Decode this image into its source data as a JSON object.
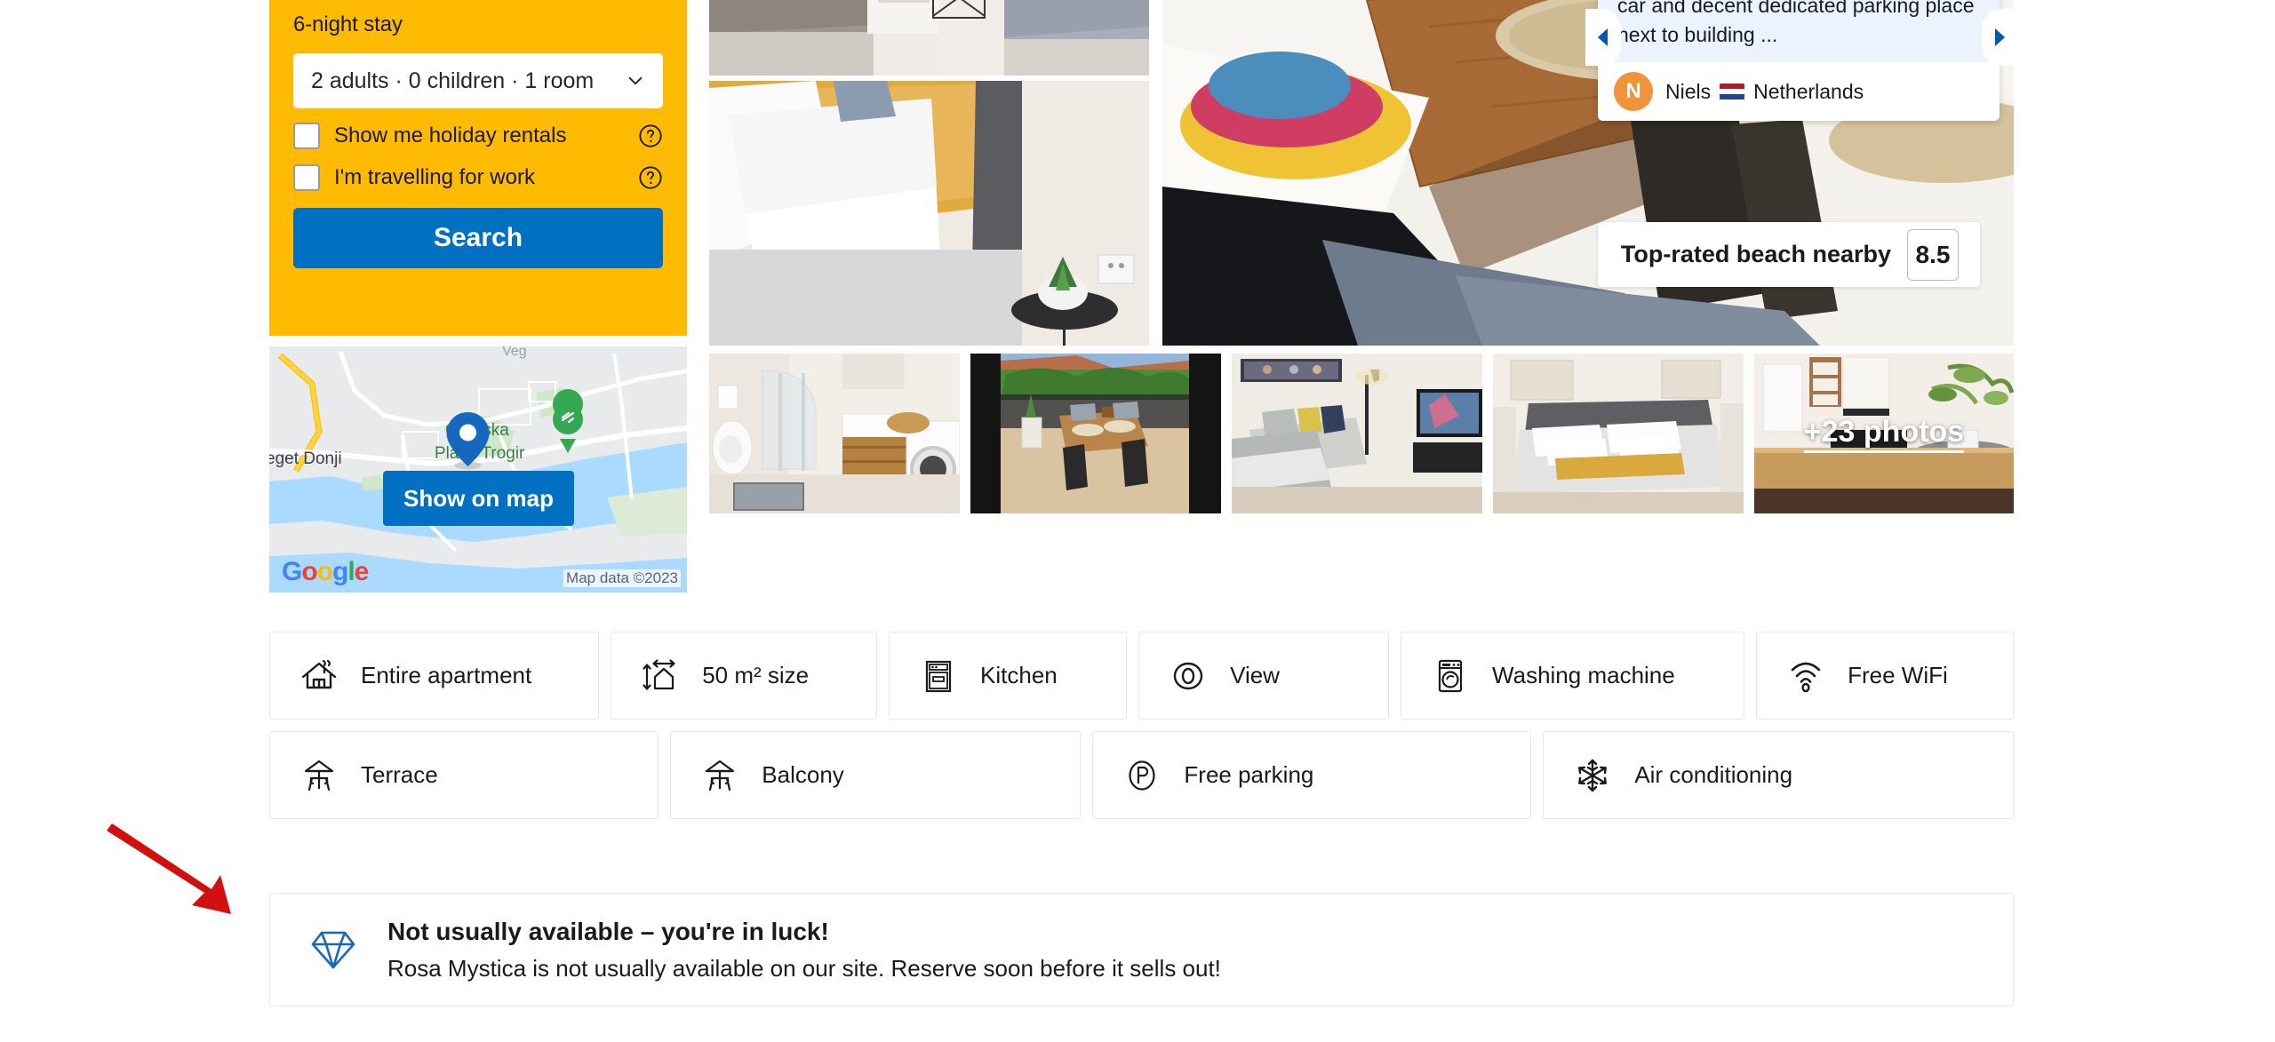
{
  "search_panel": {
    "stay_label": "6-night stay",
    "occupancy_value": "2 adults · 0 children · 1 room",
    "chevron_icon": "chevron-down-icon",
    "checkbox_holiday_rentals": "Show me holiday rentals",
    "checkbox_travelling_for_work": "I'm travelling for work",
    "help_icon": "question-mark-circle-icon",
    "search_button": "Search",
    "accent_color": "#febb02",
    "button_color": "#0071c2"
  },
  "map": {
    "show_on_map_button": "Show on map",
    "attribution": "Map data ©2023",
    "brand": "Google",
    "brand_letters": [
      "G",
      "o",
      "o",
      "g",
      "l",
      "e"
    ],
    "labels": [
      "eget Donji",
      "Gradska",
      "Plaža Trogir",
      "Veg"
    ],
    "pin_icon": "map-pin-icon"
  },
  "gallery": {
    "more_photos_label": "+23 photos",
    "prev_icon": "chevron-left-icon",
    "next_icon": "chevron-right-icon",
    "photos": [
      {
        "name": "bedroom-twin-beds-lamp"
      },
      {
        "name": "bed-white-pillow-mustard"
      },
      {
        "name": "terrace-wooden-table-main"
      },
      {
        "name": "bathroom-shower-washing-machine"
      },
      {
        "name": "balcony-dining-table"
      },
      {
        "name": "living-room-sofa-tv"
      },
      {
        "name": "bedroom-double-bed"
      },
      {
        "name": "kitchen-counter-plant"
      }
    ]
  },
  "review": {
    "text": "gave some good suggestions for dinner and beaches to visit. Easy to reach by car and decent dedicated parking place next to building ...",
    "avatar_initial": "N",
    "reviewer_name": "Niels",
    "reviewer_country": "Netherlands",
    "flag_icon": "flag-netherlands-icon"
  },
  "beach_badge": {
    "label": "Top-rated beach nearby",
    "score": "8.5"
  },
  "amenities": {
    "row1": [
      {
        "label": "Entire apartment",
        "icon": "house-icon"
      },
      {
        "label": "50 m² size",
        "icon": "size-arrows-icon"
      },
      {
        "label": "Kitchen",
        "icon": "oven-icon"
      },
      {
        "label": "View",
        "icon": "eye-icon"
      },
      {
        "label": "Washing machine",
        "icon": "washing-machine-icon"
      },
      {
        "label": "Free WiFi",
        "icon": "wifi-icon"
      }
    ],
    "row2": [
      {
        "label": "Terrace",
        "icon": "parasol-table-icon"
      },
      {
        "label": "Balcony",
        "icon": "parasol-table-icon"
      },
      {
        "label": "Free parking",
        "icon": "parking-p-icon"
      },
      {
        "label": "Air conditioning",
        "icon": "snowflake-icon"
      }
    ]
  },
  "rare_find": {
    "icon": "gem-icon",
    "title": "Not usually available – you're in luck!",
    "subtitle": "Rosa Mystica is not usually available on our site. Reserve soon before it sells out!",
    "icon_color": "#0071c2"
  },
  "annotation": {
    "arrow_color": "#d2110f",
    "name": "red-pointer-arrow"
  }
}
